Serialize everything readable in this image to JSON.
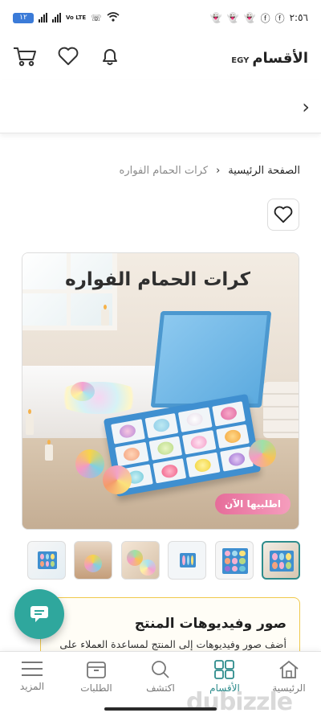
{
  "status_bar": {
    "battery": "١٢",
    "network": "Vo LTE",
    "time": "٢:٥٦"
  },
  "header": {
    "brand_ar": "الأقسام",
    "brand_suffix": "EGY",
    "icons": [
      "cart-icon",
      "heart-icon",
      "bell-icon"
    ]
  },
  "category_bar": {
    "chevron": "›"
  },
  "breadcrumb": {
    "home": "الصفحة الرئيسية",
    "separator": "‹",
    "current": "كرات الحمام الفواره"
  },
  "hero": {
    "title": "كرات الحمام الفواره",
    "cta": "اطلبيها الآن"
  },
  "thumbnails": {
    "count": 6,
    "active_index": 0
  },
  "info_card": {
    "title": "صور وفيديوهات المنتج",
    "description": "أضف صور وفيديوهات إلى المنتج لمساعدة العملاء على"
  },
  "bottom_nav": {
    "items": [
      {
        "label": "المزيد",
        "icon": "menu-icon"
      },
      {
        "label": "الطلبات",
        "icon": "orders-box-icon"
      },
      {
        "label": "اكتشف",
        "icon": "search-icon"
      },
      {
        "label": "الأقسام",
        "icon": "grid-icon"
      },
      {
        "label": "الرئيسية",
        "icon": "home-icon"
      }
    ]
  },
  "watermark": "dubizzle",
  "colors": {
    "accent": "#2e8c8c",
    "chat_fab": "#2fa79d",
    "card_border": "#f0c94c",
    "cta_pink": "#e66d9a"
  }
}
